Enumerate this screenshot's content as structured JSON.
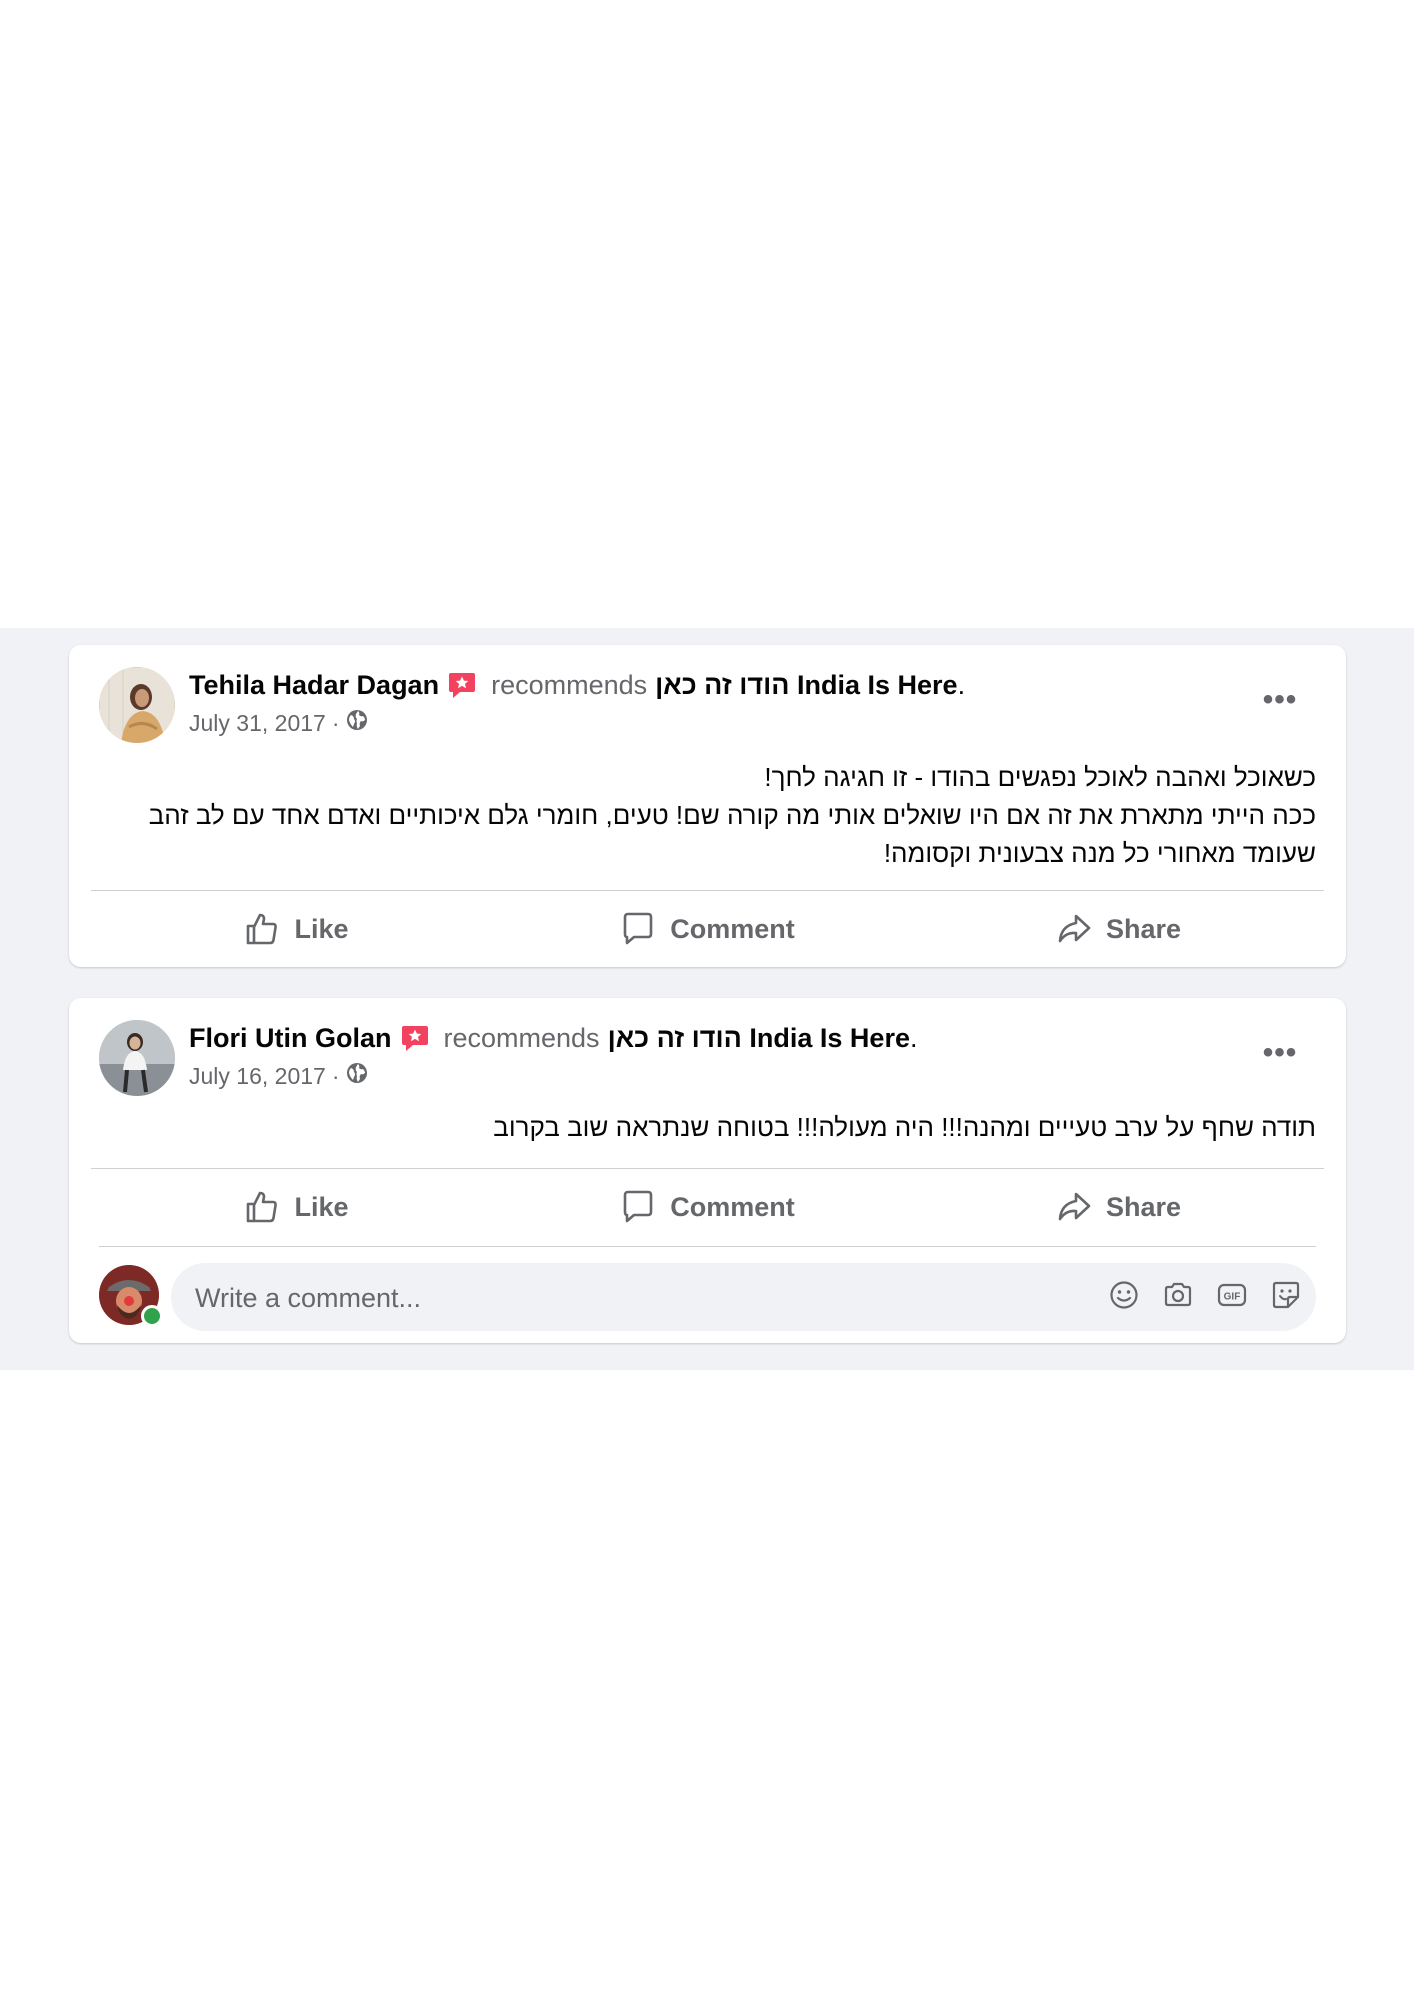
{
  "posts": [
    {
      "author": "Tehila Hadar Dagan",
      "verb": "recommends",
      "page_name_he": "הודו זה כאן",
      "page_name_en": "India Is Here",
      "date": "July 31, 2017",
      "text_lines": [
        "כשאוכל ואהבה לאוכל נפגשים בהודו - זו חגיגה לחך!",
        "ככה הייתי מתארת את זה אם היו שואלים אותי מה קורה שם! טעים, חומרי גלם איכותיים ואדם אחד עם לב זהב",
        "שעומד מאחורי כל מנה צבעונית וקסומה!"
      ],
      "actions": {
        "like": "Like",
        "comment": "Comment",
        "share": "Share"
      }
    },
    {
      "author": "Flori Utin Golan",
      "verb": "recommends",
      "page_name_he": "הודו זה כאן",
      "page_name_en": "India Is Here",
      "date": "July 16, 2017",
      "text_lines": [
        "תודה שחף על ערב טעייים ומהנה!!! היה מעולה!!! בטוחה שנתראה שוב בקרוב"
      ],
      "actions": {
        "like": "Like",
        "comment": "Comment",
        "share": "Share"
      }
    }
  ],
  "comment_box": {
    "placeholder": "Write a comment..."
  },
  "icons": {
    "more": "more-options-icon",
    "badge": "recommendation-star-icon",
    "privacy": "public-globe-icon",
    "like": "thumbs-up-icon",
    "comment": "comment-bubble-icon",
    "share": "share-arrow-icon",
    "emoji": "emoji-icon",
    "camera": "camera-icon",
    "gif": "gif-icon",
    "sticker": "sticker-icon"
  },
  "colors": {
    "background": "#f0f2f5",
    "card": "#ffffff",
    "text_primary": "#050505",
    "text_secondary": "#65676b",
    "badge_red": "#f3425f",
    "online_green": "#31a24c"
  }
}
